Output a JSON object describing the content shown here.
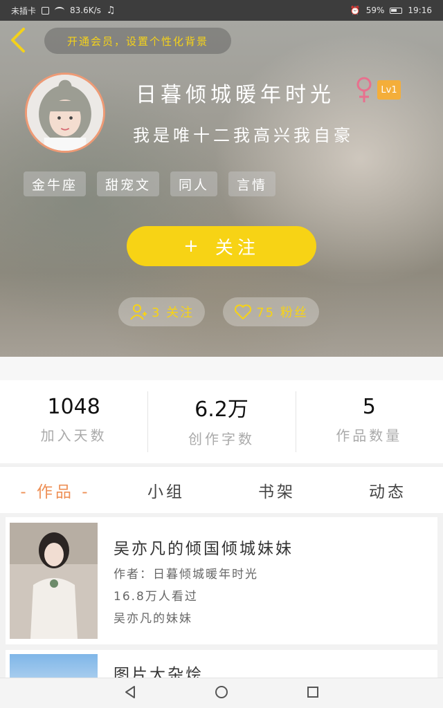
{
  "status_bar": {
    "carrier": "未插卡",
    "speed": "83.6K/s",
    "battery": "59%",
    "time": "19:16"
  },
  "header": {
    "vip_prompt": "开通会员，设置个性化背景",
    "username": "日暮倾城暖年时光",
    "level": "Lv1",
    "signature": "我是唯十二我高兴我自豪",
    "tags": [
      "金牛座",
      "甜宠文",
      "同人",
      "言情"
    ],
    "follow_button": "关注",
    "following": "3 关注",
    "fans": "75 粉丝"
  },
  "stats": [
    {
      "value": "1048",
      "label": "加入天数"
    },
    {
      "value": "6.2万",
      "label": "创作字数"
    },
    {
      "value": "5",
      "label": "作品数量"
    }
  ],
  "tabs": [
    "- 作品 -",
    "小组",
    "书架",
    "动态"
  ],
  "works": [
    {
      "title": "吴亦凡的倾国倾城妹妹",
      "author": "作者：日暮倾城暖年时光",
      "views": "16.8万人看过",
      "tag": "吴亦凡的妹妹"
    },
    {
      "title": "图片大杂烩"
    }
  ],
  "colors": {
    "accent": "#f7d315",
    "active_tab": "#ee8f55",
    "level_badge": "#f4ae3a",
    "avatar_border": "#ee9a75"
  }
}
